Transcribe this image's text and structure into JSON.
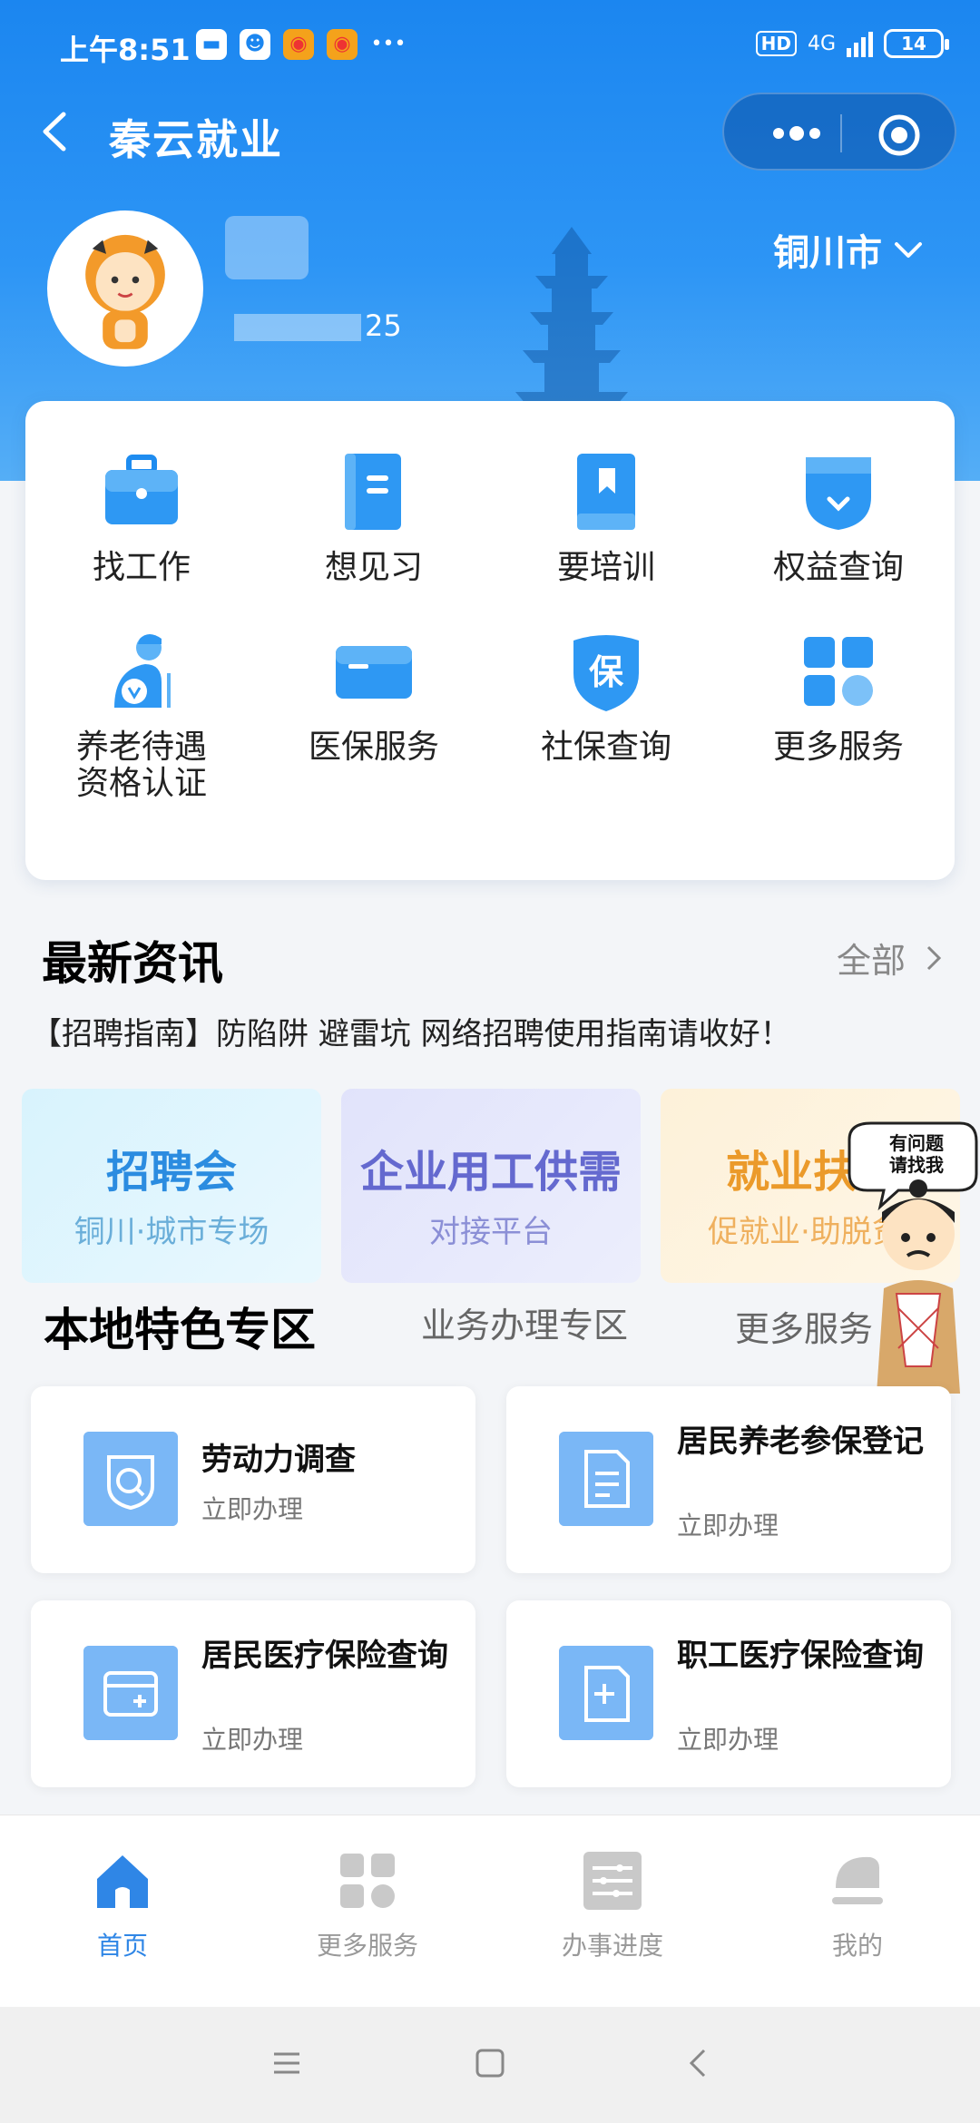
{
  "status": {
    "time": "上午8:51",
    "hd": "HD",
    "network": "4G",
    "battery": "14"
  },
  "navbar": {
    "title": "秦云就业"
  },
  "user": {
    "phone_visible": "25"
  },
  "city": {
    "label": "铜川市"
  },
  "services": [
    {
      "label": "找工作",
      "icon": "briefcase-icon"
    },
    {
      "label": "想见习",
      "icon": "notebook-icon"
    },
    {
      "label": "要培训",
      "icon": "bookmark-book-icon"
    },
    {
      "label": "权益查询",
      "icon": "shield-check-icon"
    },
    {
      "label": "养老待遇\n资格认证",
      "icon": "elder-person-icon"
    },
    {
      "label": "医保服务",
      "icon": "card-icon"
    },
    {
      "label": "社保查询",
      "icon": "bao-shield-icon"
    },
    {
      "label": "更多服务",
      "icon": "grid-icon"
    }
  ],
  "news": {
    "title": "最新资讯",
    "all_label": "全部",
    "headline": "【招聘指南】防陷阱 避雷坑 网络招聘使用指南请收好！"
  },
  "banners": [
    {
      "title": "招聘会",
      "subtitle": "铜川·城市专场"
    },
    {
      "title": "企业用工供需",
      "subtitle": "对接平台"
    },
    {
      "title": "就业扶",
      "subtitle": "促就业·助脱贫"
    }
  ],
  "mascot": {
    "bubble": "有问题\n请找我"
  },
  "zone_tabs": {
    "active": "本地特色专区",
    "second": "业务办理专区",
    "third": "更多服务"
  },
  "local_services": [
    {
      "title": "劳动力调查",
      "action": "立即办理",
      "icon": "search-shield-icon"
    },
    {
      "title": "居民养老参保登记",
      "action": "立即办理",
      "icon": "document-icon"
    },
    {
      "title": "居民医疗保险查询",
      "action": "立即办理",
      "icon": "wallet-plus-icon"
    },
    {
      "title": "职工医疗保险查询",
      "action": "立即办理",
      "icon": "medical-bag-icon"
    }
  ],
  "tabbar": [
    {
      "label": "首页",
      "icon": "home-icon",
      "active": true
    },
    {
      "label": "更多服务",
      "icon": "grid-icon",
      "active": false
    },
    {
      "label": "办事进度",
      "icon": "progress-list-icon",
      "active": false
    },
    {
      "label": "我的",
      "icon": "user-icon",
      "active": false
    }
  ],
  "colors": {
    "primary": "#1b86f0",
    "accent": "#2f86e6",
    "icon_blue": "#7ab7f6"
  }
}
